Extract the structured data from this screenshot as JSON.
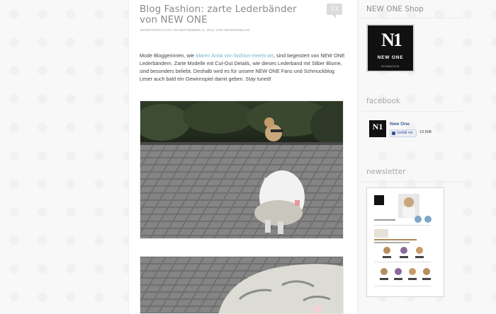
{
  "post": {
    "title": "Blog Fashion: zarte Lederbänder von NEW ONE",
    "comment_count": "13",
    "meta": "VERÖFFENTLICHT AM SEPTEMBER 5, 2012 VON NEWONEBLOG",
    "body_part1": "Mode Bloggerinnen, wie ",
    "body_link": "Maren Anita von fashion-meets-art",
    "body_part2": ", sind begeistert von NEW ONE Lederbändern. Zarte Modelle mit Cut-Out Details, wie dieses Lederband mit Silber Blume, sind besonders beliebt. Deshalb wird es für unsere NEW ONE Fans und Schmuckblog Leser auch bald ein Gewinnspiel damit geben. Stay tuned!"
  },
  "sidebar": {
    "shop_title": "NEW ONE Shop",
    "logo_mark": "N1",
    "logo_text": "NEW ONE",
    "logo_sub": "SCHMUCKIN",
    "facebook_title": "facebook",
    "fb_name": "New One",
    "fb_like_label": "Gefällt mir",
    "fb_count": "13.508",
    "newsletter_title": "newsletter"
  }
}
